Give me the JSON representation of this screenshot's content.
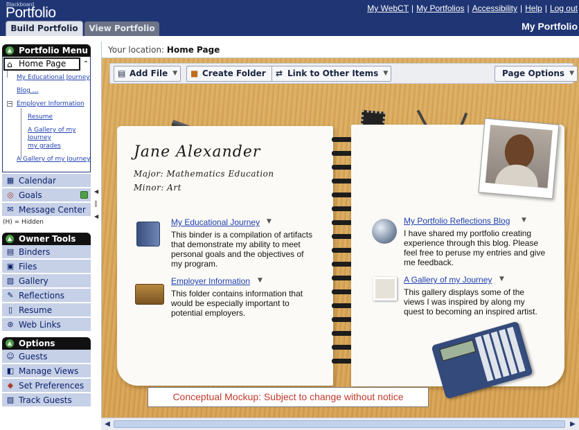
{
  "header": {
    "brand_small": "Blackboard",
    "brand_big": "Portfolio",
    "links": [
      "My WebCT",
      "My Portfolios",
      "Accessibility",
      "Help",
      "Log out"
    ],
    "tabs": {
      "active": "Build Portfolio",
      "inactive": "View Portfolio"
    },
    "title": "My Portfolio"
  },
  "sidebar": {
    "menu": {
      "title": "Portfolio Menu",
      "home": "Home Page",
      "items": [
        "My Educational Journey",
        "Blog ...",
        "Employer Information",
        "Resume",
        "A Gallery of my Journey",
        "my grades",
        "A Gallery of my Journey"
      ]
    },
    "nav": [
      "Calendar",
      "Goals",
      "Message Center"
    ],
    "hidden_note": "(H) = Hidden",
    "owner_tools": {
      "title": "Owner Tools",
      "items": [
        "Binders",
        "Files",
        "Gallery",
        "Reflections",
        "Resume",
        "Web Links"
      ]
    },
    "options": {
      "title": "Options",
      "items": [
        "Guests",
        "Manage Views",
        "Set Preferences",
        "Track Guests"
      ]
    }
  },
  "main": {
    "location_label": "Your location:",
    "location_value": "Home Page",
    "toolbar": {
      "add_file": "Add File",
      "create_folder": "Create Folder",
      "link_other": "Link to Other Items",
      "page_options": "Page Options"
    },
    "profile": {
      "name": "Jane Alexander",
      "major": "Major: Mathematics Education",
      "minor": "Minor: Art"
    },
    "items": [
      {
        "title": "My Educational Journey",
        "desc": "This binder is a compilation of artifacts that demonstrate my ability to meet personal goals and the objectives of my program."
      },
      {
        "title": "Employer Information",
        "desc": "This folder contains information that would be especially important to potential employers."
      },
      {
        "title": "My Portfolio Reflections Blog",
        "desc": "I have shared my portfolio creating experience through this blog. Please feel free to peruse my entries and give me feedback."
      },
      {
        "title": "A Gallery of my Journey",
        "desc": "This gallery displays some of the views I was inspired by along my quest to becoming an inspired artist."
      }
    ],
    "notice": "Conceptual Mockup: Subject to change without notice"
  }
}
